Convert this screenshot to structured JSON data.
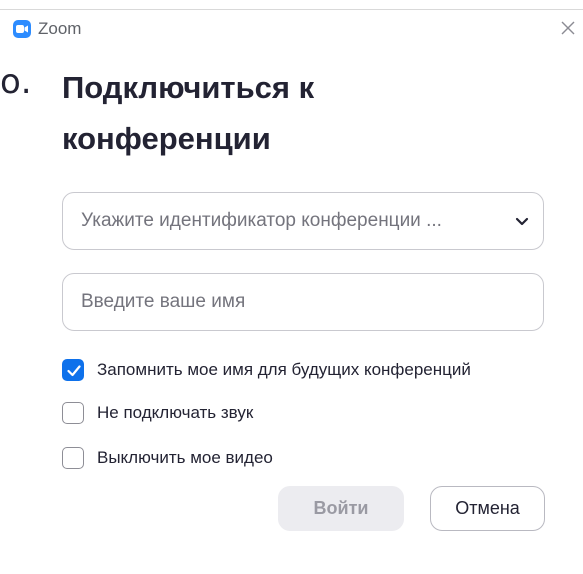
{
  "window": {
    "app_title": "Zoom",
    "icons": {
      "app": "zoom-camera-icon",
      "close": "close-icon"
    },
    "accent_color": "#0e71eb"
  },
  "stray_glyph": "о.",
  "heading": "Подключиться к конференции",
  "meeting_field": {
    "value": "",
    "placeholder": "Укажите идентификатор конференции ...",
    "icon": "chevron-down-icon"
  },
  "name_field": {
    "value": "",
    "placeholder": "Введите ваше имя"
  },
  "options": [
    {
      "label": "Запомнить мое имя для будущих конференций",
      "checked": true
    },
    {
      "label": "Не подключать звук",
      "checked": false
    },
    {
      "label": "Выключить мое видео",
      "checked": false
    }
  ],
  "buttons": {
    "join": "Войти",
    "cancel": "Отмена"
  }
}
